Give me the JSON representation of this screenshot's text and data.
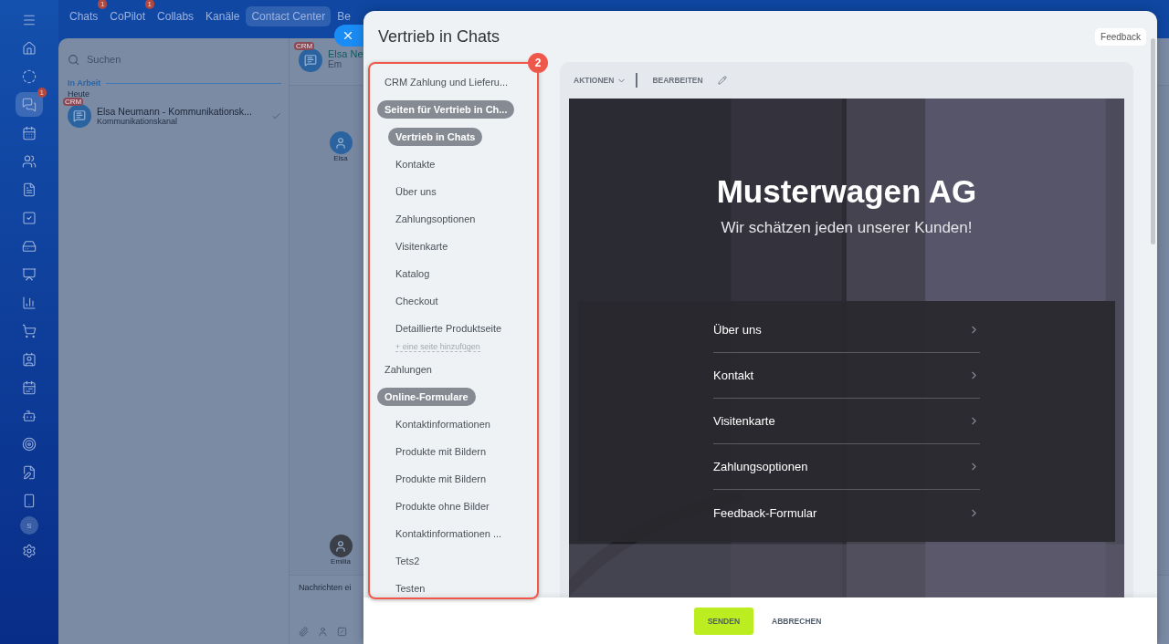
{
  "sidebar": {
    "items": [
      {
        "selected": false
      },
      {
        "selected": false
      },
      {
        "selected": false
      },
      {
        "selected": true,
        "badge": "1"
      },
      {
        "selected": false
      },
      {
        "selected": false
      },
      {
        "selected": false
      },
      {
        "selected": false
      },
      {
        "selected": false
      },
      {
        "selected": false
      },
      {
        "selected": false
      },
      {
        "selected": false
      },
      {
        "selected": false
      },
      {
        "selected": false
      },
      {
        "selected": false
      },
      {
        "selected": false
      },
      {
        "selected": false
      },
      {
        "selected": false
      }
    ],
    "user_initial": "S"
  },
  "top_tabs": [
    {
      "label": "Chats",
      "selected": false,
      "badge": "1"
    },
    {
      "label": "CoPilot",
      "selected": false,
      "badge": "1"
    },
    {
      "label": "Collabs",
      "selected": false
    },
    {
      "label": "Kanäle",
      "selected": false
    },
    {
      "label": "Contact Center",
      "selected": true
    },
    {
      "label": "Be",
      "selected": false
    }
  ],
  "chat_list": {
    "search": {
      "placeholder": "Suchen"
    },
    "section": "In Arbeit",
    "day": "Heute",
    "items": [
      {
        "tag": "CRM",
        "title": "Elsa Neumann - Kommunikationsk...",
        "subtitle": "Kommunikationskanal",
        "read": true
      }
    ]
  },
  "chat": {
    "tag": "CRM",
    "title": "Elsa Ne",
    "member": "Em",
    "participants": [
      {
        "name": "Elsa"
      },
      {
        "name": "Emilia"
      }
    ],
    "composer": {
      "placeholder": "Nachrichten ei"
    }
  },
  "slider": {
    "title": "Vertrieb in Chats",
    "feedback": "Feedback",
    "annotation": "2",
    "nav": [
      {
        "label": "CRM Zahlung und Lieferu...",
        "selected": false
      },
      {
        "label": "Seiten für Vertrieb in Ch...",
        "selected": true,
        "add_link": "+ eine seite hinzufügen",
        "children": [
          {
            "label": "Vertrieb in Chats",
            "selected": true
          },
          {
            "label": "Kontakte",
            "selected": false
          },
          {
            "label": "Über uns",
            "selected": false
          },
          {
            "label": "Zahlungsoptionen",
            "selected": false
          },
          {
            "label": "Visitenkarte",
            "selected": false
          },
          {
            "label": "Katalog",
            "selected": false
          },
          {
            "label": "Checkout",
            "selected": false
          },
          {
            "label": "Detaillierte Produktseite",
            "selected": false
          }
        ]
      },
      {
        "label": "Zahlungen",
        "selected": false
      },
      {
        "label": "Online-Formulare",
        "selected": true,
        "children": [
          {
            "label": "Kontaktinformationen",
            "selected": false
          },
          {
            "label": "Produkte mit Bildern",
            "selected": false
          },
          {
            "label": "Produkte mit Bildern",
            "selected": false
          },
          {
            "label": "Produkte ohne Bilder",
            "selected": false
          },
          {
            "label": "Kontaktinformationen ...",
            "selected": false
          },
          {
            "label": "Tets2",
            "selected": false
          },
          {
            "label": "Testen",
            "selected": false
          }
        ]
      }
    ],
    "toolbar": {
      "actions": "AKTIONEN",
      "edit": "BEARBEITEN"
    },
    "preview": {
      "heading": "Musterwagen AG",
      "tagline": "Wir schätzen jeden unserer Kunden!",
      "menu": [
        "Über uns",
        "Kontakt",
        "Visitenkarte",
        "Zahlungsoptionen",
        "Feedback-Formular"
      ]
    },
    "buttons": {
      "send": "SENDEN",
      "cancel": "ABBRECHEN"
    }
  }
}
